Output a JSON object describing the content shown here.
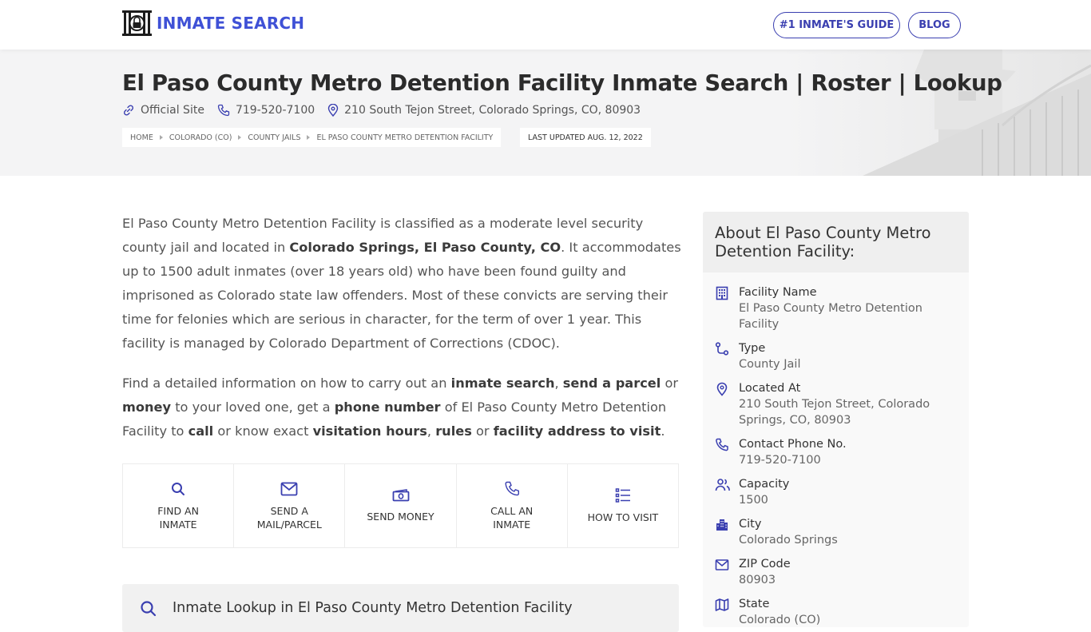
{
  "header": {
    "logo_text": "INMATE SEARCH",
    "nav": [
      {
        "label": "#1 INMATE'S GUIDE"
      },
      {
        "label": "BLOG"
      }
    ]
  },
  "hero": {
    "title": "El Paso County Metro Detention Facility Inmate Search | Roster | Lookup",
    "official_site_label": "Official Site",
    "phone": "719-520-7100",
    "address": "210 South Tejon Street, Colorado Springs, CO, 80903",
    "breadcrumbs": [
      "HOME",
      "COLORADO (CO)",
      "COUNTY JAILS",
      "EL PASO COUNTY METRO DETENTION FACILITY"
    ],
    "last_updated": "LAST UPDATED AUG. 12, 2022"
  },
  "intro": {
    "p1": [
      {
        "t": "El Paso County Metro Detention Facility is classified as a moderate level security county jail and located in ",
        "b": false
      },
      {
        "t": "Colorado Springs, El Paso County, CO",
        "b": true
      },
      {
        "t": ". It accommodates up to 1500 adult inmates (over 18 years old) who have been found guilty and imprisoned as Colorado state law offenders. Most of these convicts are serving their time for felonies which are serious in character, for the term of over 1 year. This facility is managed by Colorado Department of Corrections (CDOC).",
        "b": false
      }
    ],
    "p2": [
      {
        "t": "Find a detailed information on how to carry out an ",
        "b": false
      },
      {
        "t": "inmate search",
        "b": true
      },
      {
        "t": ", ",
        "b": false
      },
      {
        "t": "send a parcel",
        "b": true
      },
      {
        "t": " or ",
        "b": false
      },
      {
        "t": "money",
        "b": true
      },
      {
        "t": " to your loved one, get a ",
        "b": false
      },
      {
        "t": "phone number",
        "b": true
      },
      {
        "t": " of El Paso County Metro Detention Facility to ",
        "b": false
      },
      {
        "t": "call",
        "b": true
      },
      {
        "t": " or know exact ",
        "b": false
      },
      {
        "t": "visitation hours",
        "b": true
      },
      {
        "t": ", ",
        "b": false
      },
      {
        "t": "rules",
        "b": true
      },
      {
        "t": " or ",
        "b": false
      },
      {
        "t": "facility address to visit",
        "b": true
      },
      {
        "t": ".",
        "b": false
      }
    ]
  },
  "actions": [
    {
      "icon": "search-icon",
      "line1": "FIND AN",
      "line2": "INMATE"
    },
    {
      "icon": "envelope-icon",
      "line1": "SEND A",
      "line2": "MAIL/PARCEL"
    },
    {
      "icon": "money-icon",
      "line1": "SEND MONEY",
      "line2": ""
    },
    {
      "icon": "phone-icon",
      "line1": "CALL AN",
      "line2": "INMATE"
    },
    {
      "icon": "list-icon",
      "line1": "HOW TO VISIT",
      "line2": ""
    }
  ],
  "lookup": {
    "title": "Inmate Lookup in El Paso County Metro Detention Facility"
  },
  "sidebar": {
    "title": "About El Paso County Metro Detention Facility:",
    "items": [
      {
        "icon": "building-icon",
        "label": "Facility Name",
        "value": "El Paso County Metro Detention Facility"
      },
      {
        "icon": "route-icon",
        "label": "Type",
        "value": "County Jail"
      },
      {
        "icon": "map-pin-icon",
        "label": "Located At",
        "value": "210 South Tejon Street, Colorado Springs, CO, 80903"
      },
      {
        "icon": "phone-icon",
        "label": "Contact Phone No.",
        "value": "719-520-7100"
      },
      {
        "icon": "users-icon",
        "label": "Capacity",
        "value": "1500"
      },
      {
        "icon": "city-icon",
        "label": "City",
        "value": "Colorado Springs"
      },
      {
        "icon": "envelope-icon",
        "label": "ZIP Code",
        "value": "80903"
      },
      {
        "icon": "map-icon",
        "label": "State",
        "value": "Colorado (CO)"
      }
    ]
  },
  "colors": {
    "brand": "#3f51d6",
    "icon_accent": "#3a3fb0",
    "hero_bg": "#f4f4f5"
  }
}
